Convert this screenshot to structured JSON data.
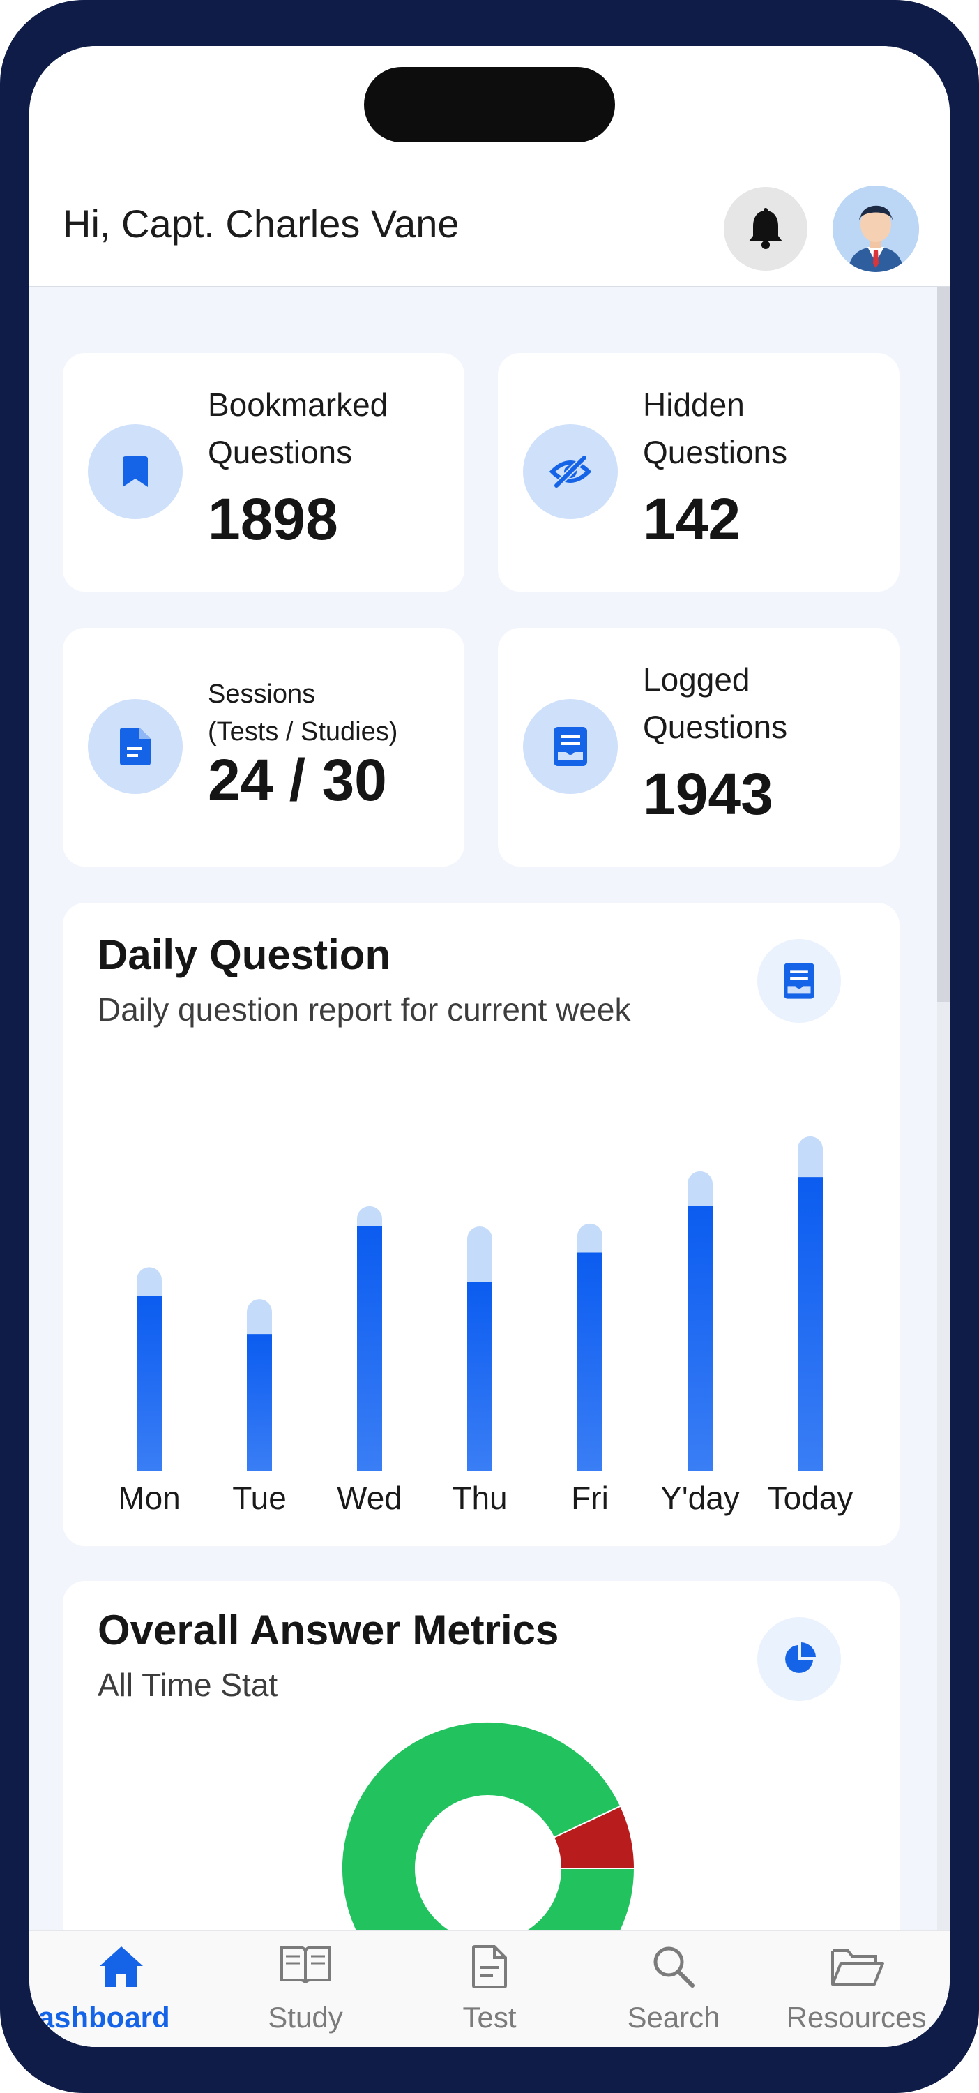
{
  "header": {
    "greeting": "Hi, Capt. Charles Vane",
    "notification_icon": "bell-icon",
    "avatar_icon": "user-avatar"
  },
  "stats": [
    {
      "label_line1": "Bookmarked",
      "label_line2": "Questions",
      "value": "1898",
      "icon": "bookmark-icon"
    },
    {
      "label_line1": "Hidden",
      "label_line2": "Questions",
      "value": "142",
      "icon": "eye-off-icon"
    },
    {
      "label_line1": "Sessions",
      "label_line2": "(Tests / Studies)",
      "value": "24 / 30",
      "icon": "document-icon"
    },
    {
      "label_line1": "Logged",
      "label_line2": "Questions",
      "value": "1943",
      "icon": "log-icon"
    }
  ],
  "daily": {
    "title": "Daily Question",
    "subtitle": "Daily question report for current week",
    "icon": "report-icon"
  },
  "chart_data": {
    "type": "bar",
    "categories": [
      "Mon",
      "Tue",
      "Wed",
      "Thu",
      "Fri",
      "Y'day",
      "Today"
    ],
    "series": [
      {
        "values": [
          60,
          47,
          84,
          65,
          75,
          91,
          101
        ]
      },
      {
        "values": [
          10,
          12,
          7,
          19,
          10,
          12,
          14
        ]
      }
    ],
    "stacked": true,
    "ylim": [
      0,
      120
    ],
    "grid": false,
    "colors": [
      "#1563f0",
      "#c4dbfa"
    ]
  },
  "metrics": {
    "title": "Overall Answer Metrics",
    "subtitle": "All Time Stat",
    "icon": "pie-chart-icon",
    "donut": {
      "type": "pie",
      "values": [
        93,
        7
      ],
      "colors": [
        "#22c35e",
        "#b81c1c"
      ]
    }
  },
  "tabs": [
    {
      "label": "Dashboard",
      "icon": "home-icon",
      "active": true
    },
    {
      "label": "Study",
      "icon": "book-icon",
      "active": false
    },
    {
      "label": "Test",
      "icon": "document-icon",
      "active": false
    },
    {
      "label": "Search",
      "icon": "search-icon",
      "active": false
    },
    {
      "label": "Resources",
      "icon": "folder-icon",
      "active": false
    }
  ],
  "colors": {
    "accent": "#1563e6",
    "frame": "#0e1c47",
    "background": "#f2f6fc"
  }
}
